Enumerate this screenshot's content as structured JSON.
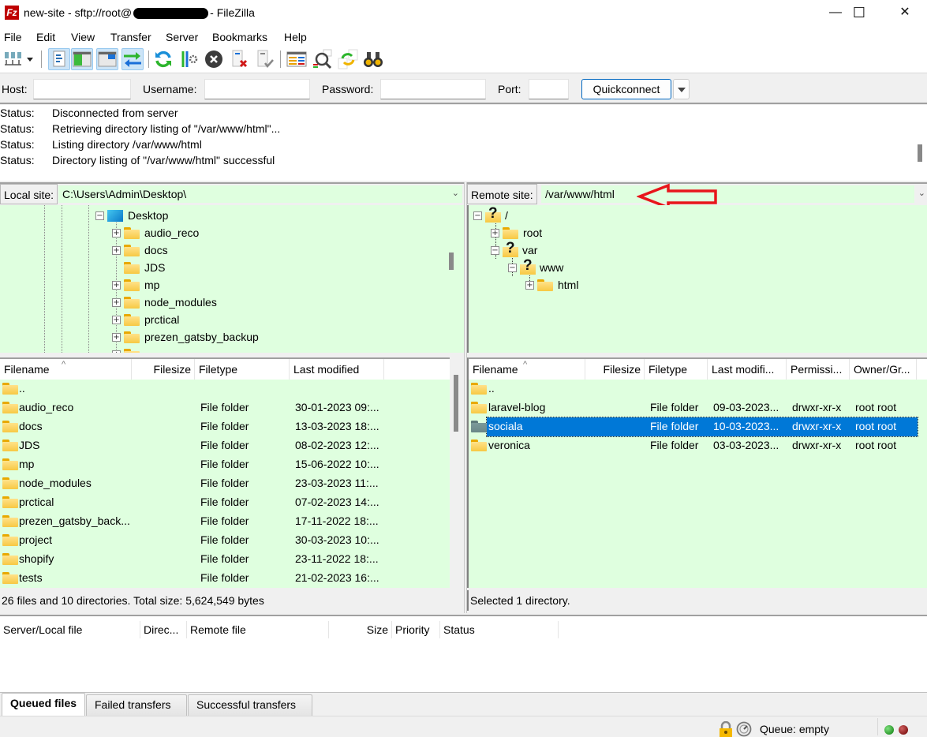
{
  "window": {
    "title_prefix": "new-site - sftp://root@",
    "title_suffix": "- FileZilla",
    "app_icon": "Fz",
    "controls": {
      "minimize": "—",
      "maximize": "☐",
      "close": "✕"
    }
  },
  "menu": [
    "File",
    "Edit",
    "View",
    "Transfer",
    "Server",
    "Bookmarks",
    "Help"
  ],
  "toolbar": {
    "buttons": [
      "site-manager-icon",
      "dropdown-arrow-icon",
      "toggle-message-log-icon",
      "toggle-local-tree-icon",
      "toggle-remote-tree-icon",
      "toggle-transfer-queue-icon",
      "refresh-icon",
      "process-queue-icon",
      "cancel-icon",
      "disconnect-icon",
      "reconnect-icon",
      "directory-listing-filters-icon",
      "compare-directories-icon",
      "synchronized-browsing-icon",
      "search-remote-files-icon"
    ]
  },
  "quickconnect": {
    "host_label": "Host:",
    "host_value": "",
    "username_label": "Username:",
    "username_value": "",
    "password_label": "Password:",
    "password_value": "",
    "port_label": "Port:",
    "port_value": "",
    "button_label": "Quickconnect"
  },
  "message_log": [
    {
      "key": "Status:",
      "text": "Disconnected from server"
    },
    {
      "key": "Status:",
      "text": "Retrieving directory listing of \"/var/www/html\"..."
    },
    {
      "key": "Status:",
      "text": "Listing directory /var/www/html"
    },
    {
      "key": "Status:",
      "text": "Directory listing of \"/var/www/html\" successful"
    }
  ],
  "local": {
    "site_label": "Local site:",
    "path": "C:\\Users\\Admin\\Desktop\\",
    "tree": {
      "root": "Desktop",
      "children": [
        "audio_reco",
        "docs",
        "JDS",
        "mp",
        "node_modules",
        "prctical",
        "prezen_gatsby_backup"
      ]
    },
    "columns": [
      "Filename",
      "Filesize",
      "Filetype",
      "Last modified"
    ],
    "files": [
      {
        "name": "..",
        "size": "",
        "type": "",
        "modified": ""
      },
      {
        "name": "audio_reco",
        "size": "",
        "type": "File folder",
        "modified": "30-01-2023 09:..."
      },
      {
        "name": "docs",
        "size": "",
        "type": "File folder",
        "modified": "13-03-2023 18:..."
      },
      {
        "name": "JDS",
        "size": "",
        "type": "File folder",
        "modified": "08-02-2023 12:..."
      },
      {
        "name": "mp",
        "size": "",
        "type": "File folder",
        "modified": "15-06-2022 10:..."
      },
      {
        "name": "node_modules",
        "size": "",
        "type": "File folder",
        "modified": "23-03-2023 11:..."
      },
      {
        "name": "prctical",
        "size": "",
        "type": "File folder",
        "modified": "07-02-2023 14:..."
      },
      {
        "name": "prezen_gatsby_back...",
        "size": "",
        "type": "File folder",
        "modified": "17-11-2022 18:..."
      },
      {
        "name": "project",
        "size": "",
        "type": "File folder",
        "modified": "30-03-2023 10:..."
      },
      {
        "name": "shopify",
        "size": "",
        "type": "File folder",
        "modified": "23-11-2022 18:..."
      },
      {
        "name": "tests",
        "size": "",
        "type": "File folder",
        "modified": "21-02-2023 16:..."
      }
    ],
    "status": "26 files and 10 directories. Total size: 5,624,549 bytes"
  },
  "remote": {
    "site_label": "Remote site:",
    "path": "/var/www/html",
    "annotation_color": "#e8151b",
    "tree": [
      {
        "label": "/",
        "icon": "unknown",
        "expander": "minus",
        "depth": 0
      },
      {
        "label": "root",
        "icon": "folder",
        "expander": "plus",
        "depth": 1
      },
      {
        "label": "var",
        "icon": "unknown",
        "expander": "minus",
        "depth": 1
      },
      {
        "label": "www",
        "icon": "unknown",
        "expander": "minus",
        "depth": 2
      },
      {
        "label": "html",
        "icon": "folder",
        "expander": "plus",
        "depth": 3
      }
    ],
    "columns": [
      "Filename",
      "Filesize",
      "Filetype",
      "Last modifi...",
      "Permissi...",
      "Owner/Gr..."
    ],
    "files": [
      {
        "name": "..",
        "size": "",
        "type": "",
        "modified": "",
        "perms": "",
        "owner": "",
        "selected": false
      },
      {
        "name": "laravel-blog",
        "size": "",
        "type": "File folder",
        "modified": "09-03-2023...",
        "perms": "drwxr-xr-x",
        "owner": "root root",
        "selected": false
      },
      {
        "name": "sociala",
        "size": "",
        "type": "File folder",
        "modified": "10-03-2023...",
        "perms": "drwxr-xr-x",
        "owner": "root root",
        "selected": true
      },
      {
        "name": "veronica",
        "size": "",
        "type": "File folder",
        "modified": "03-03-2023...",
        "perms": "drwxr-xr-x",
        "owner": "root root",
        "selected": false
      }
    ],
    "status": "Selected 1 directory."
  },
  "queue": {
    "columns": [
      "Server/Local file",
      "Direc...",
      "Remote file",
      "Size",
      "Priority",
      "Status"
    ],
    "tabs": [
      {
        "label": "Queued files",
        "active": true
      },
      {
        "label": "Failed transfers",
        "active": false
      },
      {
        "label": "Successful transfers",
        "active": false
      }
    ]
  },
  "statusbar": {
    "queue_text": "Queue: empty"
  },
  "colors": {
    "pane_bg": "#dfffdf",
    "selection": "#0078d7",
    "accent_border": "#0067c0"
  }
}
